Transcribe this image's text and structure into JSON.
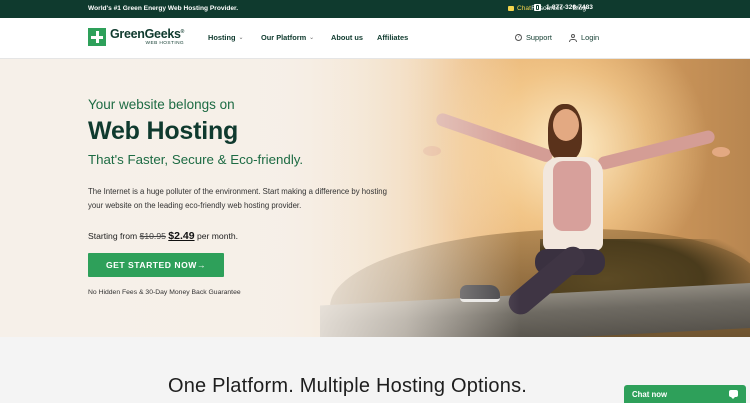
{
  "topbar": {
    "tagline": "World's #1 Green Energy Web Hosting Provider.",
    "links": [
      "Resources",
      "Blog"
    ],
    "chat_label": "Chat",
    "phone": "1-877-326-7483"
  },
  "brand": {
    "name": "GreenGeeks",
    "registered": "®",
    "sub": "WEB HOSTING",
    "color": "#2ea05a",
    "dark": "#0f3a2e"
  },
  "nav": {
    "items": [
      {
        "label": "Hosting",
        "dropdown": true
      },
      {
        "label": "Our Platform",
        "dropdown": true
      },
      {
        "label": "About us",
        "dropdown": false
      },
      {
        "label": "Affiliates",
        "dropdown": false
      }
    ],
    "support_label": "Support",
    "login_label": "Login"
  },
  "hero": {
    "subtitle": "Your website belongs on",
    "title": "Web Hosting",
    "tagline": "That's Faster, Secure & Eco-friendly.",
    "description": "The Internet is a huge polluter of the environment. Start making a difference by hosting your website on the leading eco-friendly web hosting provider.",
    "price_prefix": "Starting from",
    "old_price": "$10.95",
    "new_price": "$2.49",
    "price_suffix": "per month.",
    "cta_label": "GET STARTED NOW",
    "cta_arrow": "→",
    "guarantee": "No Hidden Fees & 30-Day Money Back Guarantee"
  },
  "section2": {
    "title": "One Platform. Multiple Hosting Options."
  },
  "chat_widget": {
    "label": "Chat now"
  }
}
